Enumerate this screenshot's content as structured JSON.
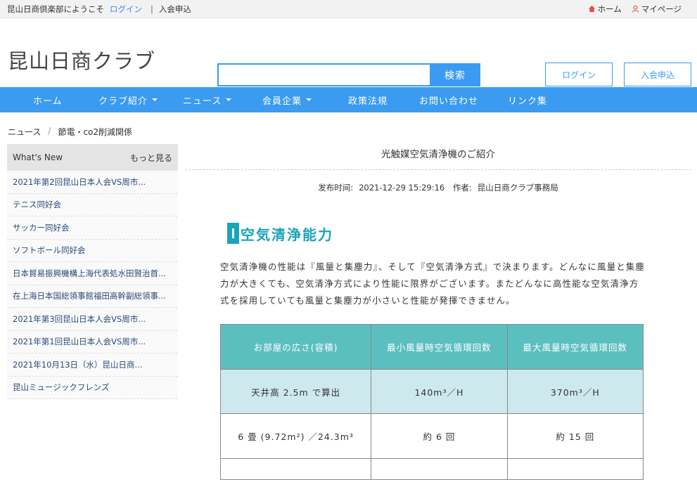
{
  "topbar": {
    "welcome": "昆山日商倶楽部にようこそ",
    "login": "ログイン",
    "separator": "|",
    "join": "入会申込",
    "home": "ホーム",
    "mypage": "マイページ"
  },
  "header": {
    "logo": "昆山日商クラブ",
    "search_placeholder": "",
    "search_button": "検索",
    "login_button": "ログイン",
    "join_button": "入会申込"
  },
  "nav": {
    "items": [
      {
        "label": "ホーム",
        "dropdown": false
      },
      {
        "label": "クラブ紹介",
        "dropdown": true
      },
      {
        "label": "ニュース",
        "dropdown": true
      },
      {
        "label": "会員企業",
        "dropdown": true
      },
      {
        "label": "政策法規",
        "dropdown": false
      },
      {
        "label": "お問い合わせ",
        "dropdown": false
      },
      {
        "label": "リンク集",
        "dropdown": false
      }
    ]
  },
  "breadcrumb": {
    "items": [
      "ニュース",
      "節電・co2削減関係"
    ],
    "separator": "/"
  },
  "sidebar": {
    "title": "What's New",
    "more": "もっと見る",
    "items": [
      "2021年第2回昆山日本人会VS周市...",
      "テニス同好会",
      "サッカー同好会",
      "ソフトボール同好会",
      "日本貿易振興機構上海代表処水田賢治首...",
      "在上海日本国総領事館福田高幹副総領事...",
      "2021年第3回昆山日本人会VS周市...",
      "2021年第1回昆山日本人会VS周市...",
      "2021年10月13日（水）昆山日商...",
      "昆山ミュージックフレンズ"
    ]
  },
  "article": {
    "title": "光触媒空気清浄機のご紹介",
    "date_label": "发布时间:",
    "date": "2021-12-29 15:29:16",
    "author_label": "作者:",
    "author": "昆山日商クラブ事務局",
    "section_title": "空気清浄能力",
    "paragraph": "空気清浄機の性能は『風量と集塵力』、そして『空気清浄方式』で決まります。どんなに風量と集塵力が大きくても、空気清浄方式により性能に限界がございます。またどんなに高性能な空気清浄方式を採用していても風量と集塵力が小さいと性能が発揮できません。",
    "table": {
      "headers": [
        "お部屋の広さ(容積)",
        "最小風量時空気循環回数",
        "最大風量時空気循環回数"
      ],
      "rows": [
        [
          "天井高 2.5m で算出",
          "140m³／H",
          "370m³／H"
        ],
        [
          "6 畳 (9.72m²) ／24.3m³",
          "約 6 回",
          "約 15 回"
        ],
        [
          "",
          "",
          ""
        ]
      ]
    }
  },
  "colors": {
    "primary": "#3a9bf0",
    "accent_teal": "#1aa4b8",
    "table_header": "#5bbfbf",
    "table_row_highlight": "#cde9ee"
  }
}
